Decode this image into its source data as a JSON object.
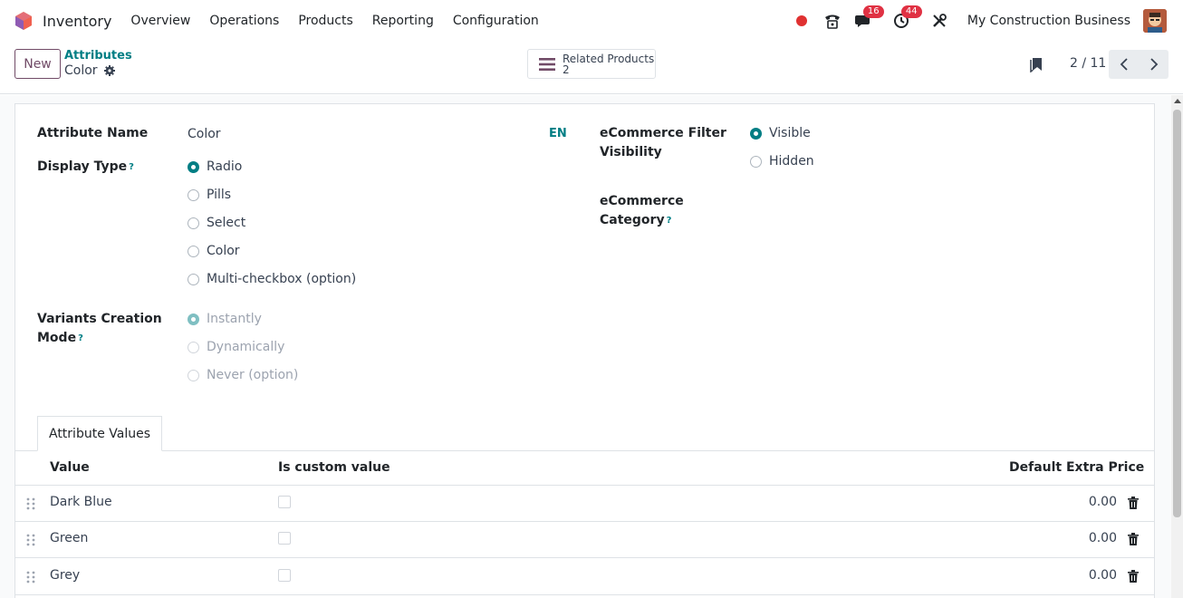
{
  "navbar": {
    "app_name": "Inventory",
    "menu": [
      "Overview",
      "Operations",
      "Products",
      "Reporting",
      "Configuration"
    ],
    "messages_badge": "16",
    "activities_badge": "44",
    "company": "My Construction Business"
  },
  "control": {
    "new_label": "New",
    "breadcrumb_parent": "Attributes",
    "breadcrumb_current": "Color",
    "smart_button_label": "Related Products",
    "smart_button_count": "2",
    "pager": "2 / 11"
  },
  "form": {
    "attribute_name_label": "Attribute Name",
    "attribute_name_value": "Color",
    "lang": "EN",
    "display_type_label": "Display Type",
    "display_type_options": [
      "Radio",
      "Pills",
      "Select",
      "Color",
      "Multi-checkbox (option)"
    ],
    "display_type_selected": "Radio",
    "variants_label_line1": "Variants Creation",
    "variants_label_line2": "Mode",
    "variants_options": [
      "Instantly",
      "Dynamically",
      "Never (option)"
    ],
    "variants_selected": "Instantly",
    "ecom_filter_label_line1": "eCommerce Filter",
    "ecom_filter_label_line2": "Visibility",
    "ecom_filter_options": [
      "Visible",
      "Hidden"
    ],
    "ecom_filter_selected": "Visible",
    "ecom_category_label_line1": "eCommerce",
    "ecom_category_label_line2": "Category",
    "help_mark": "?"
  },
  "tabs": {
    "attribute_values": "Attribute Values"
  },
  "table": {
    "headers": {
      "value": "Value",
      "is_custom": "Is custom value",
      "extra_price": "Default Extra Price"
    },
    "rows": [
      {
        "value": "Dark Blue",
        "is_custom": false,
        "price": "0.00"
      },
      {
        "value": "Green",
        "is_custom": false,
        "price": "0.00"
      },
      {
        "value": "Grey",
        "is_custom": false,
        "price": "0.00"
      }
    ]
  },
  "colors": {
    "primary": "#714b67",
    "accent": "#017e84",
    "badge": "#e03143"
  }
}
